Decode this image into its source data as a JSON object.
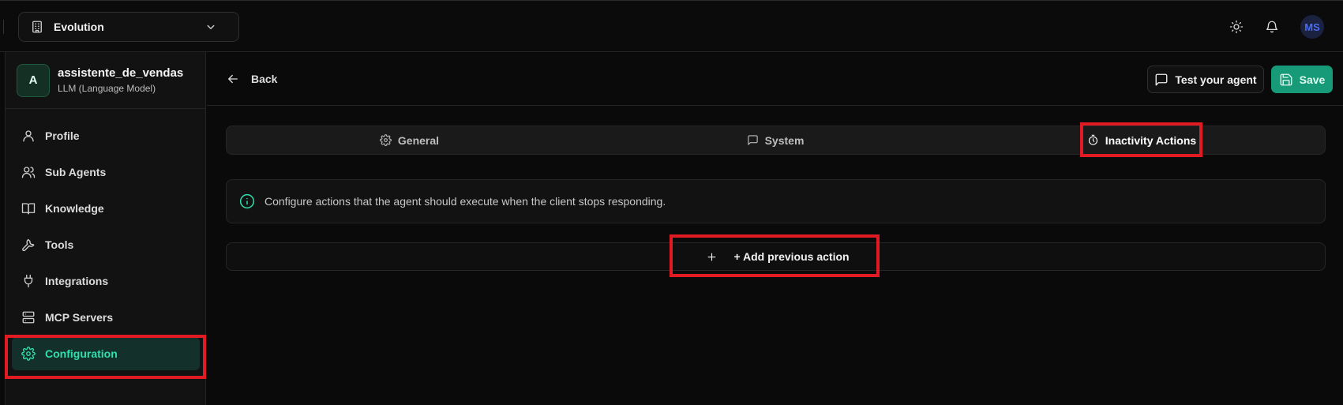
{
  "org": {
    "name": "Evolution"
  },
  "user": {
    "initials": "MS"
  },
  "agent": {
    "initial": "A",
    "name": "assistente_de_vendas",
    "type": "LLM (Language Model)"
  },
  "nav": {
    "items": [
      {
        "label": "Profile"
      },
      {
        "label": "Sub Agents"
      },
      {
        "label": "Knowledge"
      },
      {
        "label": "Tools"
      },
      {
        "label": "Integrations"
      },
      {
        "label": "MCP Servers"
      },
      {
        "label": "Configuration",
        "active": true
      }
    ]
  },
  "header": {
    "back_label": "Back",
    "test_label": "Test your agent",
    "save_label": "Save"
  },
  "tabs": [
    {
      "label": "General"
    },
    {
      "label": "System"
    },
    {
      "label": "Inactivity Actions",
      "active": true
    }
  ],
  "info": {
    "text": "Configure actions that the agent should execute when the client stops responding."
  },
  "actions": {
    "add_label": "+ Add previous action"
  },
  "colors": {
    "accent": "#2fe0ae",
    "save_bg": "#179a77",
    "highlight": "#e01b24"
  }
}
